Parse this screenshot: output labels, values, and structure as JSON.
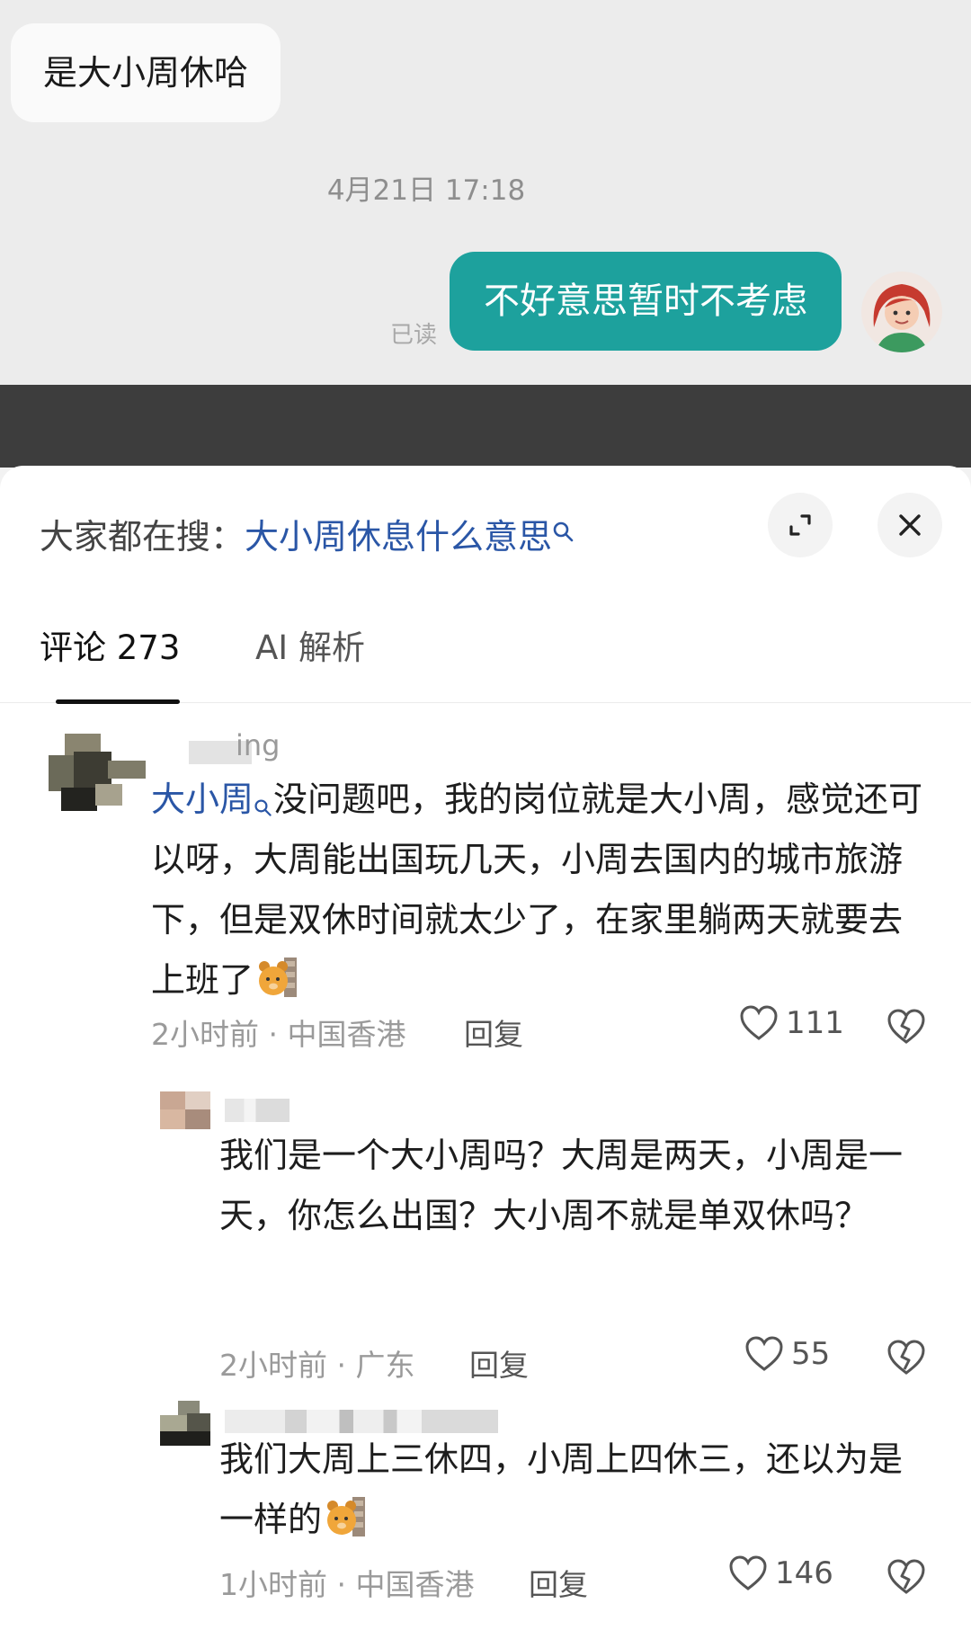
{
  "chat": {
    "incoming_message": "是大小周休哈",
    "timestamp": "4月21日 17:18",
    "outgoing_message": "不好意思暂时不考虑",
    "read_status": "已读"
  },
  "sheet": {
    "search_prefix": "大家都在搜：",
    "search_term": "大小周休息什么意思",
    "tabs": [
      {
        "label": "评论 273",
        "active": true
      },
      {
        "label": "AI 解析",
        "active": false
      }
    ]
  },
  "comments": [
    {
      "username_visible": "ing",
      "mention": "大小周",
      "text": "没问题吧，我的岗位就是大小周，感觉还可以呀，大周能出国玩几天，小周去国内的城市旅游下，但是双休时间就太少了，在家里躺两天就要去上班了",
      "time": "2小时前",
      "location": "中国香港",
      "reply_label": "回复",
      "likes": "111",
      "has_emoji": true
    },
    {
      "text": "我们是一个大小周吗？大周是两天，小周是一天，你怎么出国？大小周不就是单双休吗？",
      "time": "2小时前",
      "location": "广东",
      "reply_label": "回复",
      "likes": "55",
      "has_emoji": false
    },
    {
      "text": "我们大周上三休四，小周上四休三，还以为是一样的",
      "time": "1小时前",
      "location": "中国香港",
      "reply_label": "回复",
      "likes": "146",
      "has_emoji": true
    }
  ],
  "colors": {
    "accent_teal": "#1da19d",
    "link_blue": "#2a56a6",
    "band_dark": "#3d3d3d"
  },
  "icons": [
    "search-icon",
    "expand-icon",
    "close-icon",
    "heart-icon",
    "broken-heart-icon",
    "bear-emoji-icon"
  ]
}
